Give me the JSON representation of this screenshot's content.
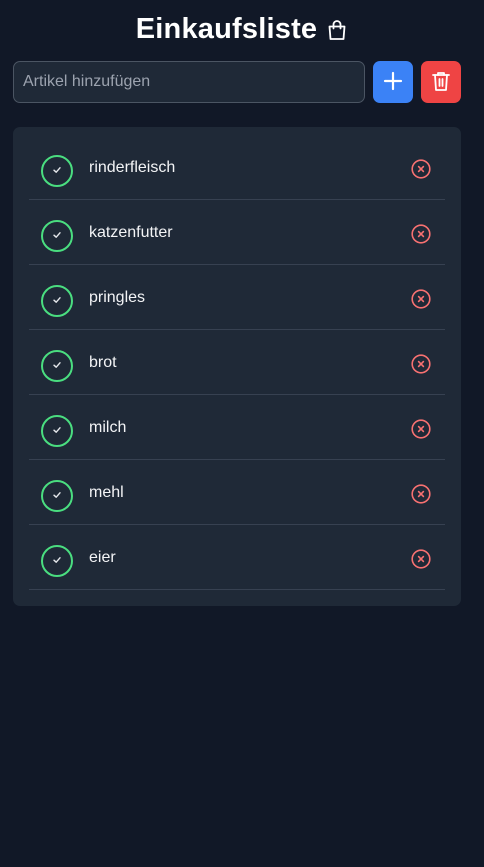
{
  "app": {
    "title": "Einkaufsliste",
    "title_icon": "shopping-bag-icon"
  },
  "input": {
    "placeholder": "Artikel hinzufügen",
    "value": ""
  },
  "buttons": {
    "add_icon": "plus-icon",
    "clear_icon": "trash-icon",
    "add_color": "#3b82f6",
    "clear_color": "#ef4444"
  },
  "items": [
    {
      "label": "rinderfleisch"
    },
    {
      "label": "katzenfutter"
    },
    {
      "label": "pringles"
    },
    {
      "label": "brot"
    },
    {
      "label": "milch"
    },
    {
      "label": "mehl"
    },
    {
      "label": "eier"
    }
  ],
  "colors": {
    "background": "#111827",
    "card": "#1f2937",
    "check": "#4ade80",
    "remove": "#f87171"
  }
}
